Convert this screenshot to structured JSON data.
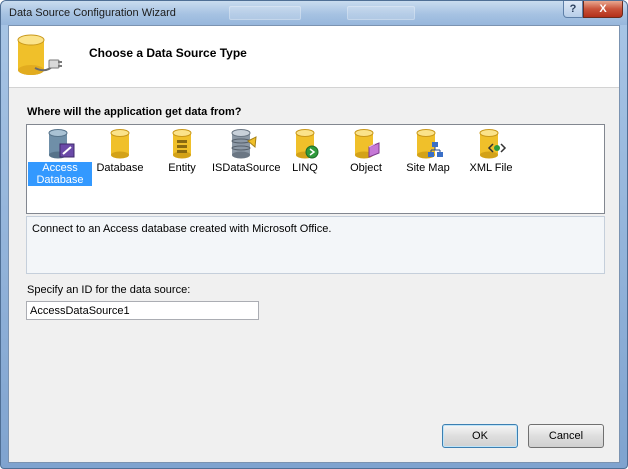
{
  "window": {
    "title": "Data Source Configuration Wizard",
    "help_label": "?",
    "close_label": "X"
  },
  "header": {
    "title": "Choose a Data Source Type",
    "icon": "database-plug-icon"
  },
  "section": {
    "label": "Where will the application get data from?"
  },
  "types": [
    {
      "label": "Access Database",
      "icon": "access-database-icon",
      "selected": true
    },
    {
      "label": "Database",
      "icon": "database-icon",
      "selected": false
    },
    {
      "label": "Entity",
      "icon": "entity-icon",
      "selected": false
    },
    {
      "label": "ISDataSource",
      "icon": "isdatasource-icon",
      "selected": false
    },
    {
      "label": "LINQ",
      "icon": "linq-icon",
      "selected": false
    },
    {
      "label": "Object",
      "icon": "object-icon",
      "selected": false
    },
    {
      "label": "Site Map",
      "icon": "site-map-icon",
      "selected": false
    },
    {
      "label": "XML File",
      "icon": "xml-file-icon",
      "selected": false
    }
  ],
  "description": "Connect to an Access database created with Microsoft Office.",
  "id_field": {
    "label": "Specify an ID for the data source:",
    "value": "AccessDataSource1"
  },
  "buttons": {
    "ok": "OK",
    "cancel": "Cancel"
  },
  "colors": {
    "selection": "#3399ff",
    "title_bar": "#a6c2e2",
    "close_button": "#c9533a",
    "cylinder_gold": "#f2c230"
  }
}
